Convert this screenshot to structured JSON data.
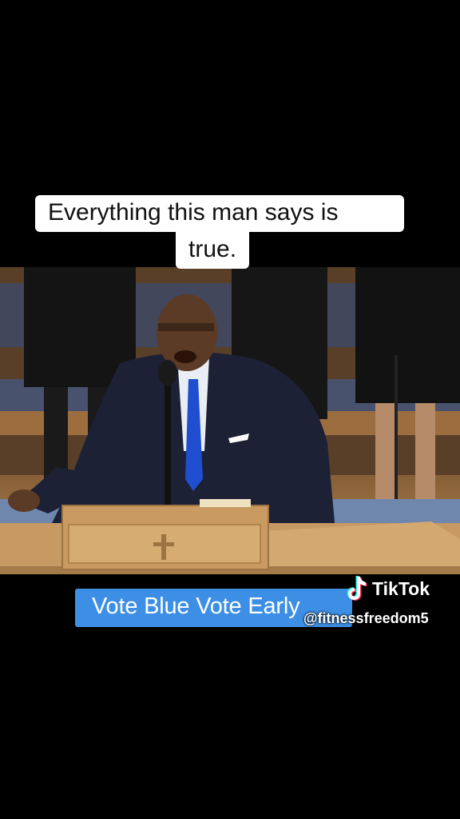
{
  "caption_top": {
    "line1": "Everything this man says is",
    "line2": "true."
  },
  "caption_bottom": {
    "text": "Vote Blue Vote Early"
  },
  "watermark": {
    "brand": "TikTok",
    "handle": "@fitnessfreedom5",
    "icon": "tiktok-note-icon"
  },
  "colors": {
    "background": "#000000",
    "caption_bg": "#ffffff",
    "banner_bg": "#3d8fe6",
    "tie": "#1f4fd0"
  }
}
